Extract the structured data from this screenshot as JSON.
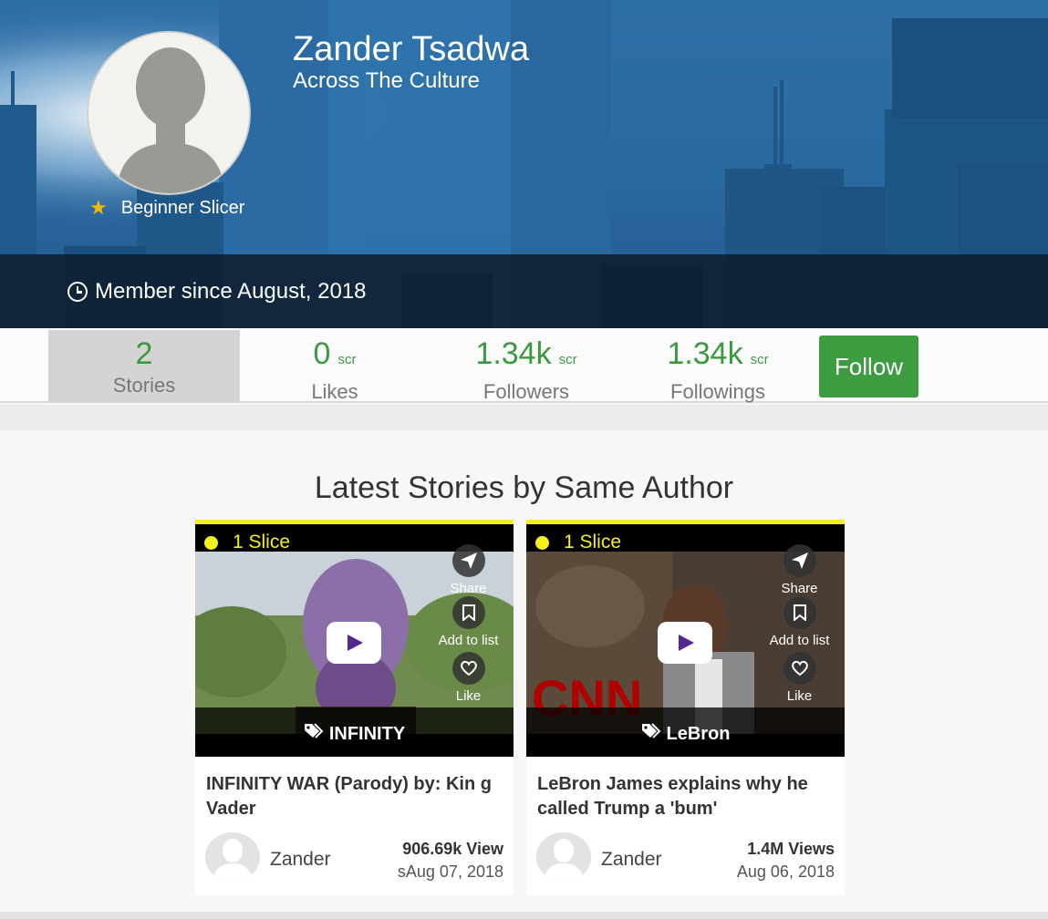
{
  "profile": {
    "name": "Zander Tsadwa",
    "tagline": "Across The Culture",
    "rank": "Beginner Slicer",
    "member_since": "Member since August, 2018"
  },
  "stats": [
    {
      "value": "2",
      "unit": "",
      "label": "Stories",
      "active": true
    },
    {
      "value": "0",
      "unit": "scr",
      "label": "Likes"
    },
    {
      "value": "1.34k",
      "unit": "scr",
      "label": "Followers"
    },
    {
      "value": "1.34k",
      "unit": "scr",
      "label": "Followings"
    }
  ],
  "follow_label": "Follow",
  "section_title": "Latest Stories by Same Author",
  "actions": {
    "share": "Share",
    "add_to_list": "Add to list",
    "like": "Like"
  },
  "cards": [
    {
      "slices": "1 Slice",
      "tag": "INFINITY",
      "title": "INFINITY WAR (Parody) by: Kin g Vader",
      "author": "Zander",
      "views": "906.69k View",
      "date": "sAug 07, 2018"
    },
    {
      "slices": "1 Slice",
      "tag": "LeBron",
      "title": "LeBron James explains why he called Trump a 'bum'",
      "author": "Zander",
      "views": "1.4M Views",
      "date": "Aug 06, 2018"
    }
  ],
  "colors": {
    "accent_green": "#3a9a3e",
    "slice_yellow": "#f4ef1f",
    "hero_blue": "#2a68a0"
  }
}
